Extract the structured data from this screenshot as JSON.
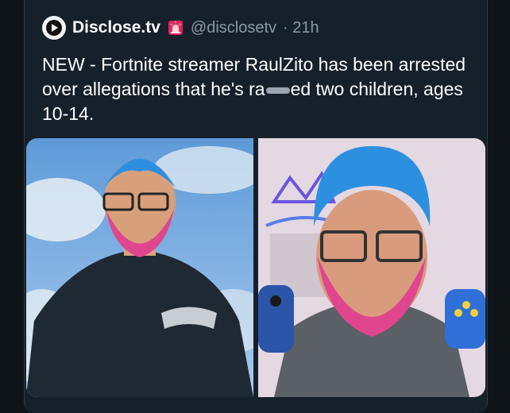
{
  "tweet": {
    "display_name": "Disclose.tv",
    "handle": "@disclosetv",
    "time": "· 21h",
    "text_before": "NEW - Fortnite streamer RaulZito has been arrested over allegations that he's ra",
    "text_after": "ed two children, ages 10-14."
  },
  "icons": {
    "avatar": "play-logo-icon",
    "badge": "siren-icon"
  },
  "colors": {
    "background": "#0f1419",
    "card": "#15202b",
    "handle_gray": "#8b98a5",
    "text": "#ffffff",
    "beard_pink": "#e0468e",
    "hair_blue": "#2d8fe0"
  }
}
